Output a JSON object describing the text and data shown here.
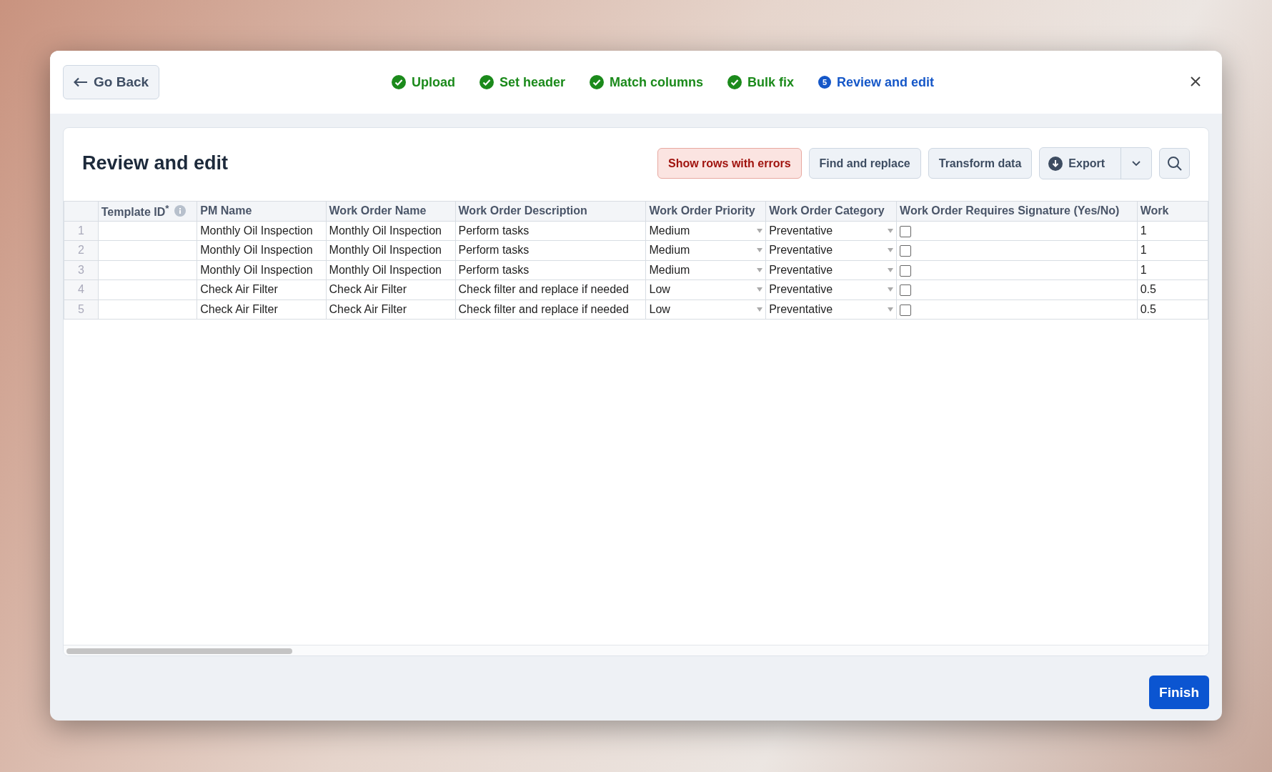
{
  "back_button": {
    "label": "Go Back"
  },
  "steps": [
    {
      "label": "Upload",
      "kind": "done"
    },
    {
      "label": "Set header",
      "kind": "done"
    },
    {
      "label": "Match columns",
      "kind": "done"
    },
    {
      "label": "Bulk fix",
      "kind": "done"
    },
    {
      "label": "Review and edit",
      "kind": "current",
      "number": "5"
    }
  ],
  "title": "Review and edit",
  "toolbar": [
    {
      "label": "Show rows with errors",
      "kind": "danger"
    },
    {
      "label": "Find and replace",
      "kind": "plain"
    },
    {
      "label": "Transform data",
      "kind": "plain"
    },
    {
      "label": "Export",
      "kind": "split"
    },
    {
      "kind": "search"
    }
  ],
  "table": {
    "columns": [
      {
        "label": "Template ID$^{*}$",
        "kind": "text",
        "info": true
      },
      {
        "label": "PM Name",
        "kind": "text",
        "info": false
      },
      {
        "label": "Work Order Name",
        "kind": "text",
        "info": false
      },
      {
        "label": "Work Order Description",
        "kind": "text",
        "info": false
      },
      {
        "label": "Work Order Priority",
        "kind": "select",
        "info": false
      },
      {
        "label": "Work Order Category",
        "kind": "select",
        "info": false
      },
      {
        "label": "Work Order Requires Signature (Yes/No)",
        "kind": "checkbox",
        "info": false
      },
      {
        "label": "Work",
        "kind": "text",
        "info": false
      }
    ],
    "rows": [
      {
        "number": "1",
        "cells": [
          "",
          "Monthly Oil Inspection",
          "Monthly Oil Inspection",
          "Perform tasks",
          "Medium",
          "Preventative",
          false,
          "1"
        ]
      },
      {
        "number": "2",
        "cells": [
          "",
          "Monthly Oil Inspection",
          "Monthly Oil Inspection",
          "Perform tasks",
          "Medium",
          "Preventative",
          false,
          "1"
        ]
      },
      {
        "number": "3",
        "cells": [
          "",
          "Monthly Oil Inspection",
          "Monthly Oil Inspection",
          "Perform tasks",
          "Medium",
          "Preventative",
          false,
          "1"
        ]
      },
      {
        "number": "4",
        "cells": [
          "",
          "Check Air Filter",
          "Check Air Filter",
          "Check filter and replace if needed",
          "Low",
          "Preventative",
          false,
          "0.5"
        ]
      },
      {
        "number": "5",
        "cells": [
          "",
          "Check Air Filter",
          "Check Air Filter",
          "Check filter and replace if needed",
          "Low",
          "Preventative",
          false,
          "0.5"
        ]
      }
    ]
  },
  "finish_button": {
    "label": "Finish"
  }
}
